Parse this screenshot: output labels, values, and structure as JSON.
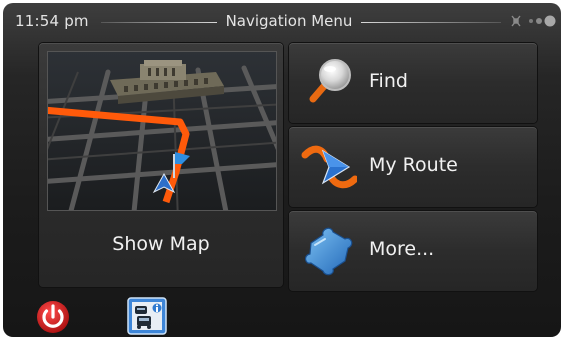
{
  "header": {
    "time": "11:54 pm",
    "title": "Navigation Menu",
    "gps_status_icon": "satellite-signal-icon"
  },
  "tiles": {
    "show_map": {
      "label": "Show Map",
      "icon": "3d-map-preview"
    },
    "find": {
      "label": "Find",
      "icon": "magnifier-icon"
    },
    "my_route": {
      "label": "My Route",
      "icon": "route-arrow-icon"
    },
    "more": {
      "label": "More...",
      "icon": "puzzle-piece-icon"
    }
  },
  "bottom_bar": {
    "power_icon": "power-icon",
    "traffic_icon": "traffic-info-icon"
  },
  "colors": {
    "background": "#1c1c1c",
    "tile": "#2e2e2e",
    "text": "#f1f1f1",
    "route_accent": "#ff5a0a",
    "power_red": "#d81e1e"
  }
}
